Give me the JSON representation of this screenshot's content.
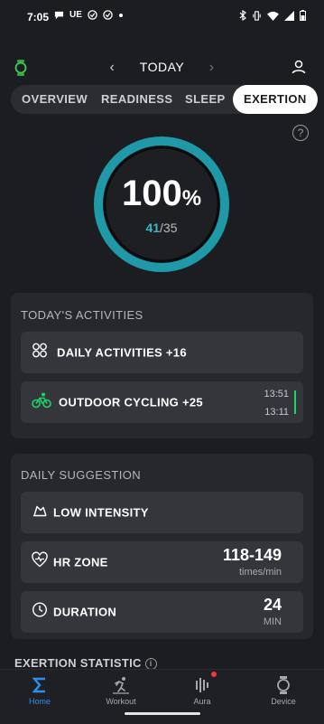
{
  "status_bar": {
    "time": "7:05",
    "carrier": "UE"
  },
  "top_nav": {
    "date_label": "TODAY",
    "prev_arrow": "‹",
    "next_arrow": "›"
  },
  "tabs": [
    {
      "label": "OVERVIEW",
      "active": false
    },
    {
      "label": "READINESS",
      "active": false
    },
    {
      "label": "SLEEP",
      "active": false
    },
    {
      "label": "EXERTION",
      "active": true
    }
  ],
  "help_icon": "?",
  "gauge": {
    "percent": "100",
    "percent_unit": "%",
    "current": "41",
    "target": "/35",
    "progress": 1.0,
    "color": "#1f98a8"
  },
  "activities": {
    "title": "TODAY'S ACTIVITIES",
    "items": [
      {
        "label": "DAILY ACTIVITIES +16",
        "icon": "apps-icon"
      },
      {
        "label": "OUTDOOR CYCLING +25",
        "icon": "cycling-icon",
        "start_time": "13:51",
        "end_time": "13:11",
        "icon_color": "#1fd36b"
      }
    ]
  },
  "suggestion": {
    "title": "DAILY SUGGESTION",
    "intensity": {
      "label": "LOW INTENSITY",
      "icon": "intensity-icon"
    },
    "hr_zone": {
      "label": "HR ZONE",
      "value": "118-149",
      "unit": "times/min",
      "icon": "heart-icon"
    },
    "duration": {
      "label": "DURATION",
      "value": "24",
      "unit": "MIN",
      "icon": "clock-icon"
    }
  },
  "statistic": {
    "title": "EXERTION STATISTIC",
    "info": "i"
  },
  "bottom_nav": [
    {
      "label": "Home",
      "icon": "sigma-icon",
      "active": true
    },
    {
      "label": "Workout",
      "icon": "running-icon",
      "active": false
    },
    {
      "label": "Aura",
      "icon": "aura-icon",
      "active": false
    },
    {
      "label": "Device",
      "icon": "watch-icon",
      "active": false
    }
  ],
  "colors": {
    "accent": "#2c8ff0",
    "ring": "#1f98a8",
    "cycling": "#1fd36b",
    "background": "#1b1d20",
    "card": "#26282c"
  }
}
